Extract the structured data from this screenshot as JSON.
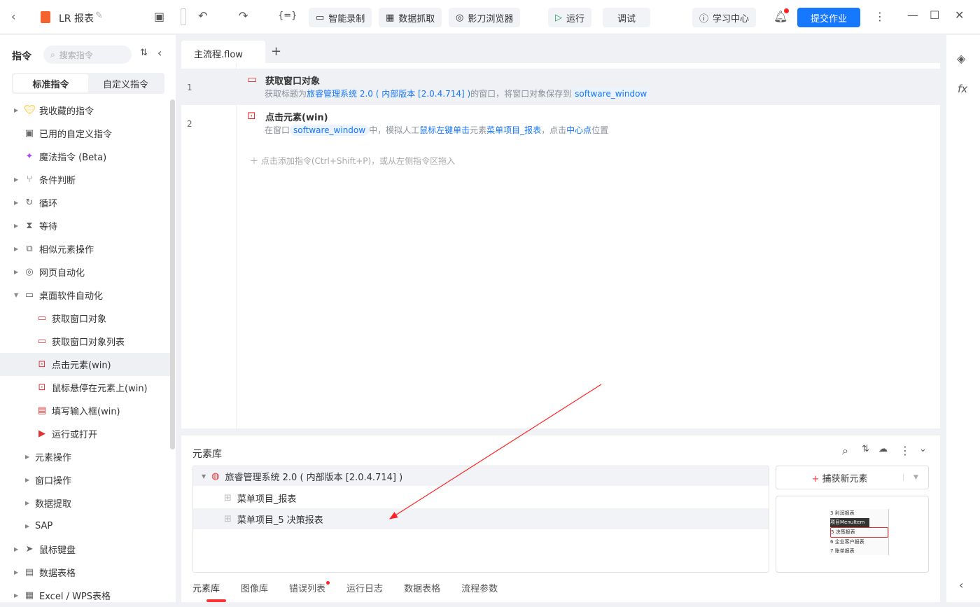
{
  "header": {
    "title": "LR 报表",
    "buttons": {
      "record": "智能录制",
      "scrape": "数据抓取",
      "browser": "影刀浏览器",
      "run": "运行",
      "debug": "调试",
      "learn": "学习中心",
      "submit": "提交作业"
    }
  },
  "sidebar": {
    "title": "指令",
    "search_placeholder": "搜索指令",
    "tabs": [
      "标准指令",
      "自定义指令"
    ],
    "items": [
      {
        "label": "我收藏的指令",
        "icon": "heart-icon",
        "arrow": true
      },
      {
        "label": "已用的自定义指令",
        "icon": "bag-icon",
        "arrow": false
      },
      {
        "label": "魔法指令 (Beta)",
        "icon": "sparkle-icon",
        "arrow": false
      },
      {
        "label": "条件判断",
        "icon": "branch-icon",
        "arrow": true
      },
      {
        "label": "循环",
        "icon": "loop-icon",
        "arrow": true
      },
      {
        "label": "等待",
        "icon": "hourglass-icon",
        "arrow": true
      },
      {
        "label": "相似元素操作",
        "icon": "copy-icon",
        "arrow": true
      },
      {
        "label": "网页自动化",
        "icon": "chrome-icon",
        "arrow": true
      },
      {
        "label": "桌面软件自动化",
        "icon": "monitor-icon",
        "arrow": "open"
      },
      {
        "label": "获取窗口对象",
        "icon": "window-icon",
        "sub": true
      },
      {
        "label": "获取窗口对象列表",
        "icon": "window-icon",
        "sub": true
      },
      {
        "label": "点击元素(win)",
        "icon": "click-icon",
        "sub": true,
        "selected": true
      },
      {
        "label": "鼠标悬停在元素上(win)",
        "icon": "hover-icon",
        "sub": true
      },
      {
        "label": "填写输入框(win)",
        "icon": "input-icon",
        "sub": true
      },
      {
        "label": "运行或打开",
        "icon": "play-icon",
        "sub": true
      },
      {
        "label": "元素操作",
        "arrow": true,
        "indent": true
      },
      {
        "label": "窗口操作",
        "arrow": true,
        "indent": true
      },
      {
        "label": "数据提取",
        "arrow": true,
        "indent": true
      },
      {
        "label": "SAP",
        "arrow": true,
        "indent": true
      },
      {
        "label": "鼠标键盘",
        "icon": "cursor-icon",
        "arrow": true
      },
      {
        "label": "数据表格",
        "icon": "doc-icon",
        "arrow": true
      },
      {
        "label": "Excel / WPS表格",
        "icon": "excel-icon",
        "arrow": true
      }
    ]
  },
  "editor": {
    "tab": "主流程.flow",
    "steps": [
      {
        "num": "1",
        "title": "获取窗口对象",
        "parts": [
          [
            "获取标题为",
            "g"
          ],
          [
            "旅睿管理系统 2.0 ( 内部版本 [2.0.4.714] )",
            "b"
          ],
          [
            "的窗口，将窗口对象保存到",
            "g"
          ],
          [
            "software_window",
            "p"
          ]
        ]
      },
      {
        "num": "2",
        "title": "点击元素(win)",
        "parts": [
          [
            "在窗口",
            "g"
          ],
          [
            "software_window",
            "p"
          ],
          [
            "中，模拟人工",
            "g"
          ],
          [
            "鼠标左键单击",
            "b"
          ],
          [
            "元素",
            "g"
          ],
          [
            "菜单项目_报表",
            "b"
          ],
          [
            "，点击",
            "g"
          ],
          [
            "中心点",
            "b"
          ],
          [
            "位置",
            "g"
          ]
        ]
      }
    ],
    "add_hint": "点击添加指令(Ctrl+Shift+P)，或从左侧指令区拖入"
  },
  "library": {
    "title": "元素库",
    "root": "旅睿管理系统 2.0 ( 内部版本 [2.0.4.714] )",
    "items": [
      "菜单项目_报表",
      "菜单项目_5 决策报表"
    ],
    "capture": "捕获新元素",
    "preview": [
      "3 利润报表",
      "项目MenuItem",
      "5 决策报表",
      "6 企业客户报表",
      "7 账单报表"
    ],
    "tabs": [
      "元素库",
      "图像库",
      "错误列表",
      "运行日志",
      "数据表格",
      "流程参数"
    ]
  }
}
